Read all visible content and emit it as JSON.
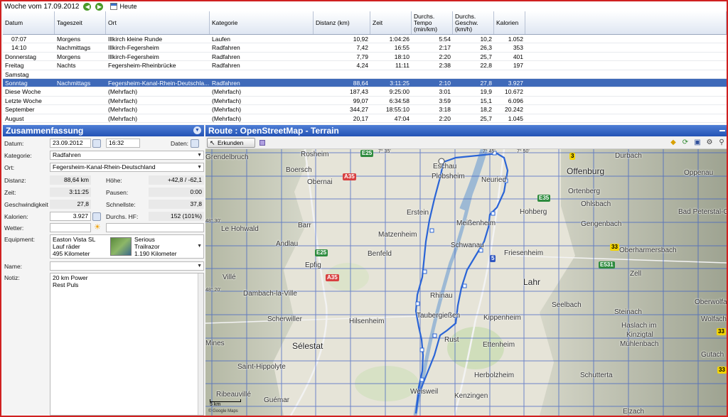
{
  "topbar": {
    "title": "Woche vom 17.09.2012",
    "today_label": "Heute"
  },
  "grid": {
    "columns": [
      "Datum",
      "Tageszeit",
      "Ort",
      "Kategorie",
      "Distanz (km)",
      "Zeit",
      "Durchs.\nTempo\n(min/km)",
      "Durchs.\nGeschw.\n(km/h)",
      "Kalorien"
    ],
    "rows": [
      [
        "07:07",
        "Morgens",
        "Illkirch kleine Runde",
        "Laufen",
        "10,92",
        "1:04:26",
        "5:54",
        "10,2",
        "1.052"
      ],
      [
        "14:10",
        "Nachmittags",
        "Illkirch-Fegersheim",
        "Radfahren",
        "7,42",
        "16:55",
        "2:17",
        "26,3",
        "353"
      ],
      [
        "Donnerstag",
        "Morgens",
        "Illkirch-Fegersheim",
        "Radfahren",
        "7,79",
        "18:10",
        "2:20",
        "25,7",
        "401"
      ],
      [
        "Freitag",
        "Nachts",
        "Fegersheim-Rheinbrücke",
        "Radfahren",
        "4,24",
        "11:11",
        "2:38",
        "22,8",
        "197"
      ],
      [
        "Samstag",
        "",
        "",
        "",
        "",
        "",
        "",
        "",
        ""
      ],
      [
        "Sonntag",
        "Nachmittags",
        "Fegersheim-Kanal-Rhein-Deutschla...",
        "Radfahren",
        "88,64",
        "3:11:25",
        "2:10",
        "27,8",
        "3.927"
      ],
      [
        "Diese Woche",
        "",
        "(Mehrfach)",
        "(Mehrfach)",
        "187,43",
        "9:25:00",
        "3:01",
        "19,9",
        "10.672"
      ],
      [
        "Letzte Woche",
        "",
        "(Mehrfach)",
        "(Mehrfach)",
        "99,07",
        "6:34:58",
        "3:59",
        "15,1",
        "6.096"
      ],
      [
        "September",
        "",
        "(Mehrfach)",
        "(Mehrfach)",
        "344,27",
        "18:55:10",
        "3:18",
        "18,2",
        "20.242"
      ],
      [
        "August",
        "",
        "(Mehrfach)",
        "(Mehrfach)",
        "20,17",
        "47:04",
        "2:20",
        "25,7",
        "1.045"
      ]
    ]
  },
  "summary": {
    "title": "Zusammenfassung",
    "date_label": "Datum:",
    "date_value": "23.09.2012",
    "time_value": "16:32",
    "data_label": "Daten:",
    "category_label": "Kategorie:",
    "category_value": "Radfahren",
    "place_label": "Ort:",
    "place_value": "Fegersheim-Kanal-Rhein-Deutschland",
    "distance_label": "Distanz:",
    "distance_value": "88,64 km",
    "height_label": "Höhe:",
    "height_value": "+42,8 / -62,1",
    "time_label": "Zeit:",
    "time_val": "3:11:25",
    "pause_label": "Pausen:",
    "pause_value": "0:00",
    "speed_label": "Geschwindigkeit",
    "speed_value": "27,8",
    "fastest_label": "Schnellste:",
    "fastest_value": "37,8",
    "calories_label": "Kalorien:",
    "calories_value": "3.927",
    "hr_label": "Durchs. HF:",
    "hr_value": "152 (101%)",
    "weather_label": "Wetter:",
    "equipment_label": "Equipment:",
    "equipment": [
      {
        "line1": "Easton Vista SL",
        "line2": "Lauf räder",
        "line3": "495 Kilometer"
      },
      {
        "line1": "Serious",
        "line2": "Trailrazor",
        "line3": "1.190 Kilometer"
      }
    ],
    "name_label": "Name:",
    "notes_label": "Notiz:",
    "notes_line1": "20 km Power",
    "notes_line2": "Rest Puls"
  },
  "map_panel": {
    "title": "Route : OpenStreetMap - Terrain",
    "explore_label": "Erkunden",
    "scale_label": "5 km",
    "attribution": "© Google Maps",
    "places": [
      {
        "name": "Grendelbruch",
        "big": false
      },
      {
        "name": "Rosheim",
        "big": false
      },
      {
        "name": "Eschau",
        "big": false
      },
      {
        "name": "Plobsheim",
        "big": false
      },
      {
        "name": "Neuried",
        "big": false
      },
      {
        "name": "Offenburg",
        "big": true
      },
      {
        "name": "Durbach",
        "big": false
      },
      {
        "name": "Oppenau",
        "big": false
      },
      {
        "name": "Boersch",
        "big": false
      },
      {
        "name": "Obernai",
        "big": false
      },
      {
        "name": "Ortenberg",
        "big": false
      },
      {
        "name": "Ohlsbach",
        "big": false
      },
      {
        "name": "Erstein",
        "big": false
      },
      {
        "name": "Hohberg",
        "big": false
      },
      {
        "name": "Bad Peterstal-Griesba",
        "big": false
      },
      {
        "name": "Le Hohwald",
        "big": false
      },
      {
        "name": "Barr",
        "big": false
      },
      {
        "name": "Matzenheim",
        "big": false
      },
      {
        "name": "Meißenheim",
        "big": false
      },
      {
        "name": "Gengenbach",
        "big": false
      },
      {
        "name": "Andlau",
        "big": false
      },
      {
        "name": "Benfeld",
        "big": false
      },
      {
        "name": "Schwanau",
        "big": false
      },
      {
        "name": "Friesenheim",
        "big": false
      },
      {
        "name": "Oberharmersbach",
        "big": false
      },
      {
        "name": "Epfig",
        "big": false
      },
      {
        "name": "Villé",
        "big": false
      },
      {
        "name": "Zell",
        "big": false
      },
      {
        "name": "Lahr",
        "big": true
      },
      {
        "name": "Dambach-la-Ville",
        "big": false
      },
      {
        "name": "Rhinau",
        "big": false
      },
      {
        "name": "Seelbach",
        "big": false
      },
      {
        "name": "Oberwolfa",
        "big": false
      },
      {
        "name": "Scherwiller",
        "big": false
      },
      {
        "name": "Taubergießen",
        "big": false
      },
      {
        "name": "Steinach",
        "big": false
      },
      {
        "name": "Wolfach",
        "big": false
      },
      {
        "name": "Hilsenheim",
        "big": false
      },
      {
        "name": "Kippenheim",
        "big": false
      },
      {
        "name": "Haslach im",
        "big": false
      },
      {
        "name": "Kinzigtal",
        "big": false
      },
      {
        "name": "Mines",
        "big": false
      },
      {
        "name": "Sélestat",
        "big": true
      },
      {
        "name": "Rust",
        "big": false
      },
      {
        "name": "Ettenheim",
        "big": false
      },
      {
        "name": "Mühlenbach",
        "big": false
      },
      {
        "name": "Gutach",
        "big": false
      },
      {
        "name": "Saint-Hippolyte",
        "big": false
      },
      {
        "name": "Herbolzheim",
        "big": false
      },
      {
        "name": "Schutterta",
        "big": false
      },
      {
        "name": "Ribeauvillé",
        "big": false
      },
      {
        "name": "Guémar",
        "big": false
      },
      {
        "name": "Weisweil",
        "big": false
      },
      {
        "name": "Kenzingen",
        "big": false
      },
      {
        "name": "Elzach",
        "big": false
      }
    ],
    "road_shields": [
      {
        "label": "E25",
        "kind": "green"
      },
      {
        "label": "A35",
        "kind": "red"
      },
      {
        "label": "3",
        "kind": "yellow"
      },
      {
        "label": "E35",
        "kind": "green"
      },
      {
        "label": "E25",
        "kind": "green"
      },
      {
        "label": "5",
        "kind": "blue"
      },
      {
        "label": "33",
        "kind": "yellow"
      },
      {
        "label": "E531",
        "kind": "green"
      },
      {
        "label": "A35",
        "kind": "red"
      },
      {
        "label": "33",
        "kind": "yellow"
      },
      {
        "label": "33",
        "kind": "yellow"
      }
    ],
    "grid_labels": [
      "48° 30'",
      "48° 25'",
      "48° 20'",
      "7° 30'",
      "7° 35'",
      "7° 40'",
      "7° 45'",
      "7° 50'"
    ]
  }
}
